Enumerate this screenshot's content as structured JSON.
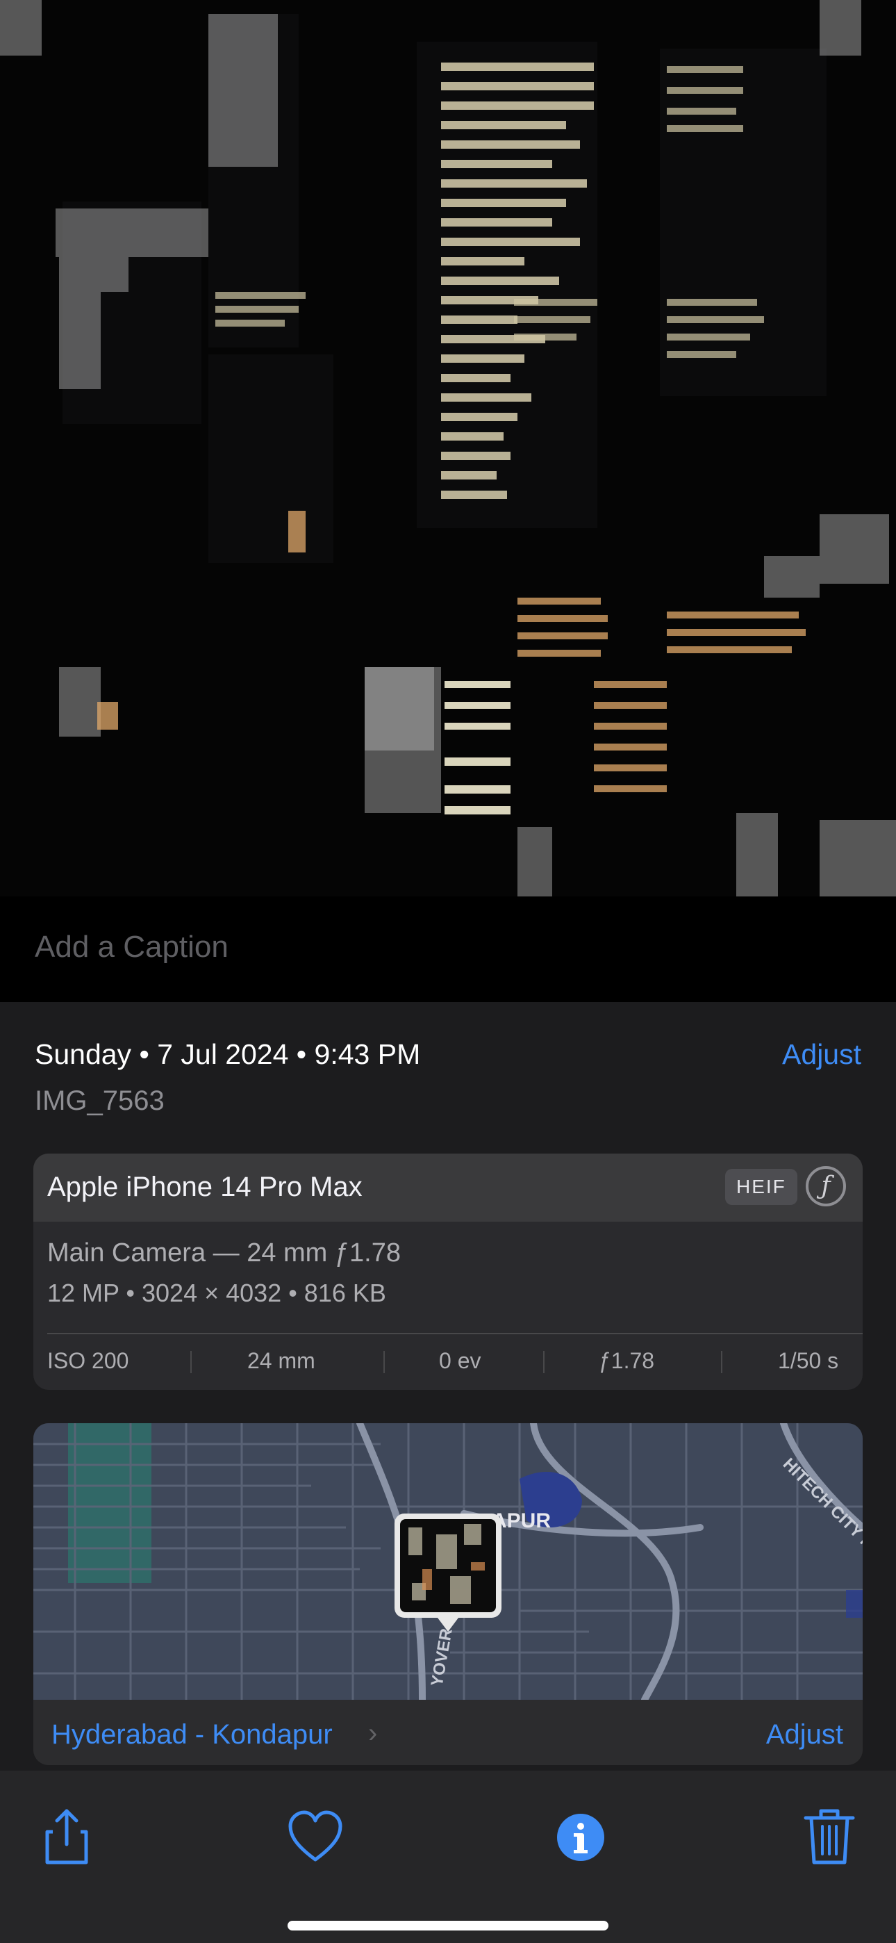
{
  "caption": {
    "placeholder": "Add a Caption"
  },
  "info": {
    "date_line": "Sunday • 7 Jul 2024 • 9:43 PM",
    "adjust_label": "Adjust",
    "filename": "IMG_7563"
  },
  "camera": {
    "device": "Apple iPhone 14 Pro Max",
    "format_badge": "HEIF",
    "aperture_icon_glyph": "ƒ",
    "lens": "Main Camera — 24 mm ƒ1.78",
    "specs": "12 MP  •  3024 × 4032  •  816 KB",
    "exif": [
      "ISO 200",
      "24 mm",
      "0 ev",
      "ƒ1.78",
      "1/50 s"
    ]
  },
  "map": {
    "labels": [
      "APUR",
      "HITECH CITY M",
      "YOVER"
    ],
    "place": "Hyderabad - Kondapur",
    "chevron": "›",
    "adjust_label": "Adjust"
  },
  "toolbar": {
    "icons": [
      "share-icon",
      "heart-icon",
      "info-icon",
      "trash-icon"
    ]
  },
  "colors": {
    "accent": "#3e8cf5",
    "sheet_bg": "#1c1c1e",
    "card_bg": "#2a2a2d"
  }
}
